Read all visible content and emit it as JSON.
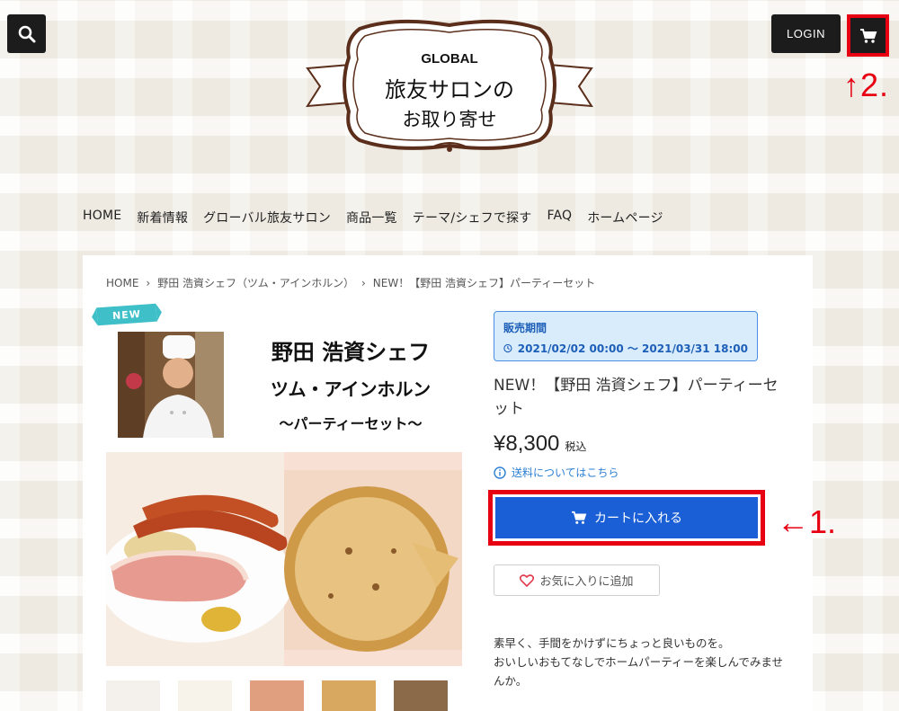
{
  "header": {
    "search_icon": "search-icon",
    "login_label": "LOGIN",
    "cart_icon": "cart-icon",
    "annotation_cart": "↑2."
  },
  "logo": {
    "brand": "GLOBAL",
    "line1": "旅友サロンの",
    "line2": "お取り寄せ"
  },
  "nav": {
    "items": [
      "HOME",
      "新着情報",
      "グローバル旅友サロン",
      "商品一覧",
      "テーマ/シェフで探す",
      "FAQ",
      "ホームページ"
    ]
  },
  "breadcrumb": {
    "items": [
      "HOME",
      "野田 浩資シェフ（ツム・アインホルン）",
      "NEW！【野田 浩資シェフ】パーティーセット"
    ]
  },
  "product": {
    "badge": "NEW",
    "hero_line1": "野田 浩資シェフ",
    "hero_line2": "ツム・アインホルン",
    "hero_line3": "〜パーティーセット〜",
    "sale_period_label": "販売期間",
    "sale_period_dates": "2021/02/02 00:00 〜 2021/03/31 18:00",
    "title": "NEW！【野田 浩資シェフ】パーティーセット",
    "price": "¥8,300",
    "tax_label": "税込",
    "shipping_link": "送料についてはこちら",
    "add_to_cart_label": "カートに入れる",
    "annotation_add": "←1.",
    "favorite_label": "お気に入りに追加",
    "description_line1": "素早く、手間をかけずにちょっと良いものを。",
    "description_line2": "おいしいおもてなしでホームパーティーを楽しんでみませんか。"
  },
  "colors": {
    "accent_blue": "#1a5fd6",
    "annotation_red": "#e60012",
    "badge_teal": "#3fc0c8",
    "period_bg": "#d8ecfb"
  }
}
